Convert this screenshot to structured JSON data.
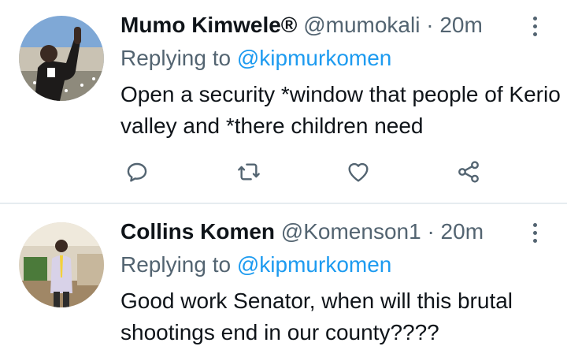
{
  "tweets": [
    {
      "name": "Mumo Kimwele®",
      "handle": "@mumokali",
      "separator": "·",
      "time": "20m",
      "replying_label": "Replying to",
      "replying_to": "@kipmurkomen",
      "text": "Open a security *window that people of Kerio valley and *there children need",
      "actions": [
        "reply-icon",
        "retweet-icon",
        "like-icon",
        "share-icon"
      ]
    },
    {
      "name": "Collins Komen",
      "handle": "@Komenson1",
      "separator": "·",
      "time": "20m",
      "replying_label": "Replying to",
      "replying_to": "@kipmurkomen",
      "text": "Good work Senator, when will this brutal shootings end in our county????"
    }
  ],
  "colors": {
    "text": "#0f1419",
    "secondary": "#536471",
    "link": "#1d9bf0",
    "divider": "#e6ecf0"
  }
}
